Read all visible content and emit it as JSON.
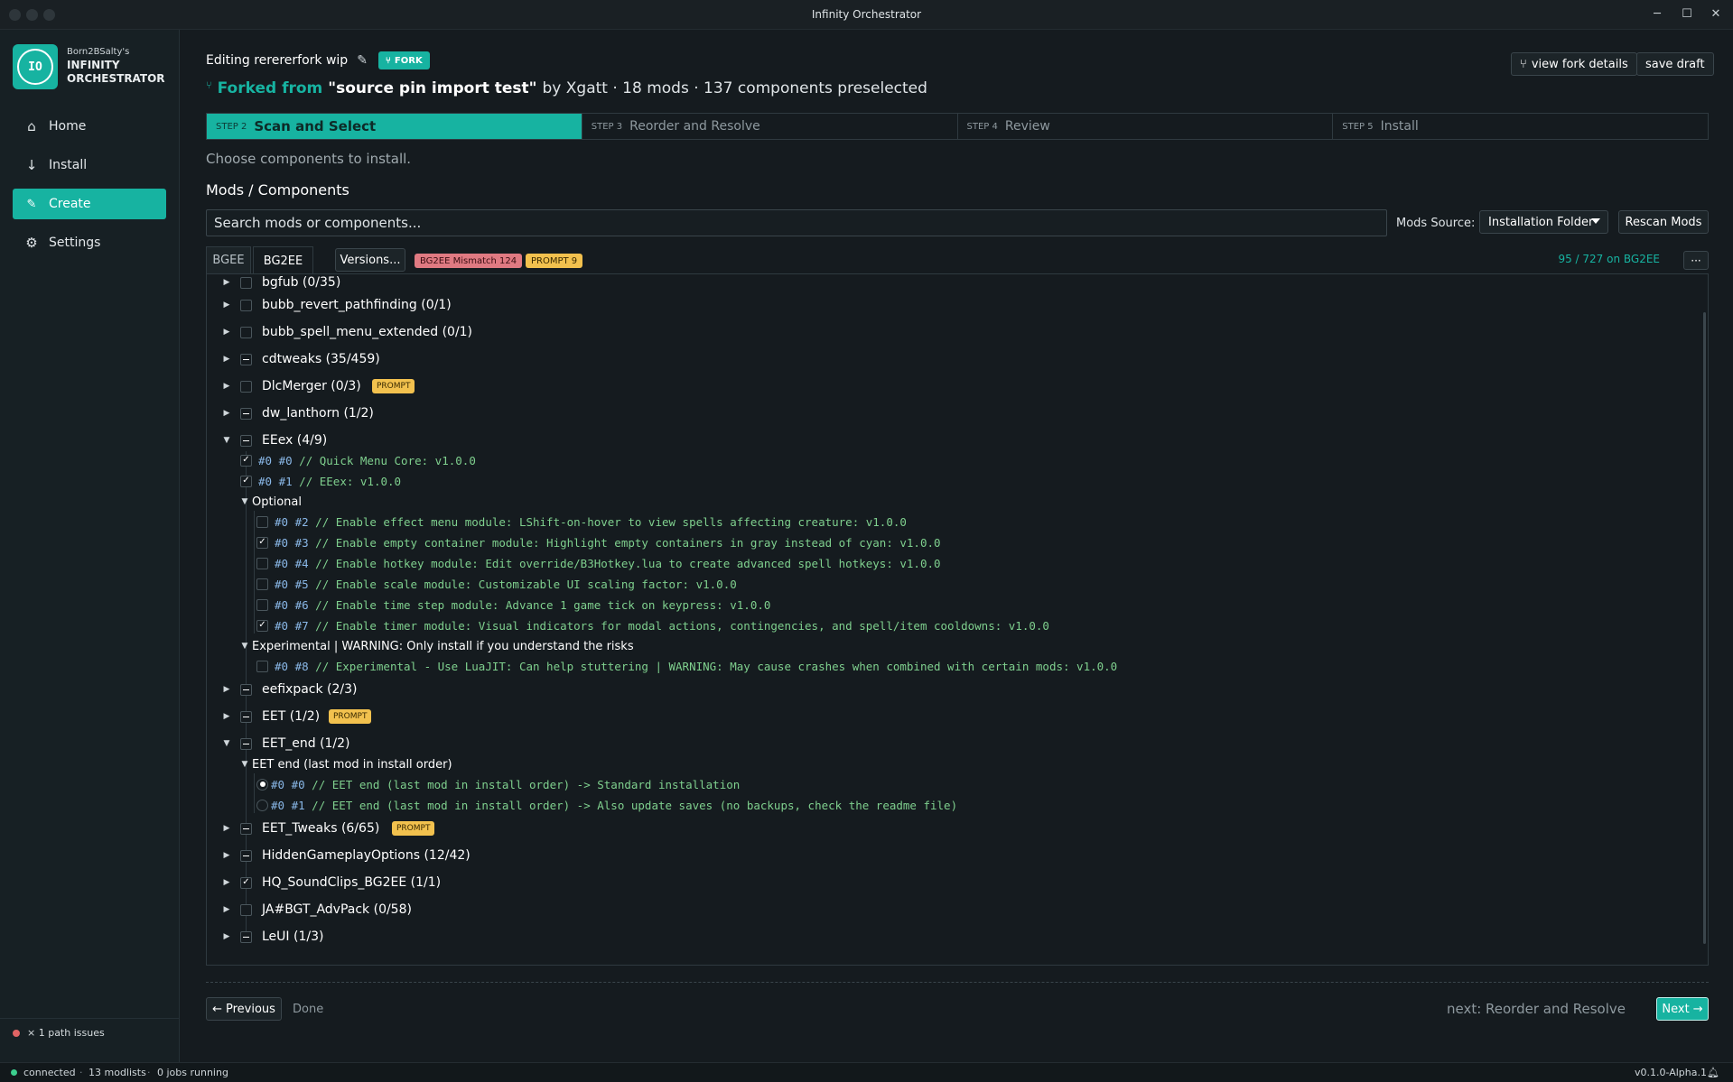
{
  "window": {
    "title": "Infinity Orchestrator",
    "controls": {
      "minimize": "─",
      "maximize": "☐",
      "close": "✕"
    }
  },
  "sidebar": {
    "brand_sub": "Born2BSalty's",
    "brand_name_1": "INFINITY",
    "brand_name_2": "ORCHESTRATOR",
    "logo_text": "IO",
    "nav": [
      {
        "label": "Home",
        "icon": "home-icon",
        "glyph": "⌂"
      },
      {
        "label": "Install",
        "icon": "download-arrow-icon",
        "glyph": "↓"
      },
      {
        "label": "Create",
        "icon": "pencil-icon",
        "glyph": "✎",
        "active": true
      },
      {
        "label": "Settings",
        "icon": "gear-icon",
        "glyph": "⚙"
      }
    ],
    "path_issues": "× 1 path issues"
  },
  "status_bar": {
    "connected": "connected",
    "modlists": "13 modlists",
    "jobs": "0 jobs running",
    "version": "v0.1.0-Alpha.1",
    "sep": "·"
  },
  "header": {
    "editing": "Editing rerererfork wip",
    "fork_badge": "FORK",
    "forked_from_label": "Forked from",
    "forked_from_name": "\"source pin import test\"",
    "forked_meta": "by Xgatt · 18 mods · 137 components preselected",
    "view_fork_details": "view fork details",
    "save_draft": "save draft"
  },
  "steps": [
    {
      "num": "STEP 2",
      "label": "Scan and Select",
      "active": true
    },
    {
      "num": "STEP 3",
      "label": "Reorder and Resolve"
    },
    {
      "num": "STEP 4",
      "label": "Review"
    },
    {
      "num": "STEP 5",
      "label": "Install"
    }
  ],
  "subtitle": "Choose components to install.",
  "section_title": "Mods / Components",
  "search": {
    "placeholder": "Search mods or components..."
  },
  "mods_source": {
    "label": "Mods Source:",
    "value": "Installation Folder",
    "rescan": "Rescan Mods"
  },
  "tabs": {
    "bgee": "BGEE",
    "bg2ee": "BG2EE",
    "versions": "Versions...",
    "mismatch": "BG2EE Mismatch 124",
    "prompt": "PROMPT 9",
    "count": "95 / 727 on BG2EE",
    "more": "···"
  },
  "prompt_chip": "PROMPT",
  "mods": {
    "bgfub": "bgfub (0/35)",
    "bubb_revert": "bubb_revert_pathfinding (0/1)",
    "bubb_spell": "bubb_spell_menu_extended (0/1)",
    "cdtweaks": "cdtweaks (35/459)",
    "dlcmerger": "DlcMerger (0/3)",
    "dw_lanthorn": "dw_lanthorn (1/2)",
    "eeex": "EEex (4/9)",
    "eefixpack": "eefixpack (2/3)",
    "eet": "EET (1/2)",
    "eet_end": "EET_end (1/2)",
    "eet_tweaks": "EET_Tweaks (6/65)",
    "hidden": "HiddenGameplayOptions (12/42)",
    "hq": "HQ_SoundClips_BG2EE (1/1)",
    "ja": "JA#BGT_AdvPack (0/58)",
    "leui": "LeUI (1/3)"
  },
  "eeex": {
    "c0": {
      "hash": "#0 #0",
      "text": "// Quick Menu Core: v1.0.0"
    },
    "c1": {
      "hash": "#0 #1",
      "text": "// EEex: v1.0.0"
    },
    "optional": "Optional",
    "c2": {
      "hash": "#0 #2",
      "text": "// Enable effect menu module: LShift-on-hover to view spells affecting creature: v1.0.0"
    },
    "c3": {
      "hash": "#0 #3",
      "text": "// Enable empty container module: Highlight empty containers in gray instead of cyan: v1.0.0"
    },
    "c4": {
      "hash": "#0 #4",
      "text": "// Enable hotkey module: Edit override/B3Hotkey.lua to create advanced spell hotkeys: v1.0.0"
    },
    "c5": {
      "hash": "#0 #5",
      "text": "// Enable scale module: Customizable UI scaling factor: v1.0.0"
    },
    "c6": {
      "hash": "#0 #6",
      "text": "// Enable time step module: Advance 1 game tick on keypress: v1.0.0"
    },
    "c7": {
      "hash": "#0 #7",
      "text": "// Enable timer module: Visual indicators for modal actions, contingencies, and spell/item cooldowns: v1.0.0"
    },
    "experimental": "Experimental | WARNING: Only install if you understand the risks",
    "c8": {
      "hash": "#0 #8",
      "text": "// Experimental - Use LuaJIT: Can help stuttering | WARNING: May cause crashes when combined with certain mods: v1.0.0"
    }
  },
  "eet_end": {
    "group": "EET end (last mod in install order)",
    "c0": {
      "hash": "#0 #0",
      "text": "// EET end (last mod in install order) -> Standard installation"
    },
    "c1": {
      "hash": "#0 #1",
      "text": "// EET end (last mod in install order) -> Also update saves (no backups, check the readme file)"
    }
  },
  "footer": {
    "previous": "Previous",
    "done": "Done",
    "next_label": "next: Reorder and Resolve",
    "next": "Next"
  },
  "colors": {
    "accent": "#17b3a1",
    "prompt": "#f2c14e",
    "mismatch": "#e07a82",
    "component_text": "#7fd08e",
    "component_index": "#8ab8e8"
  }
}
